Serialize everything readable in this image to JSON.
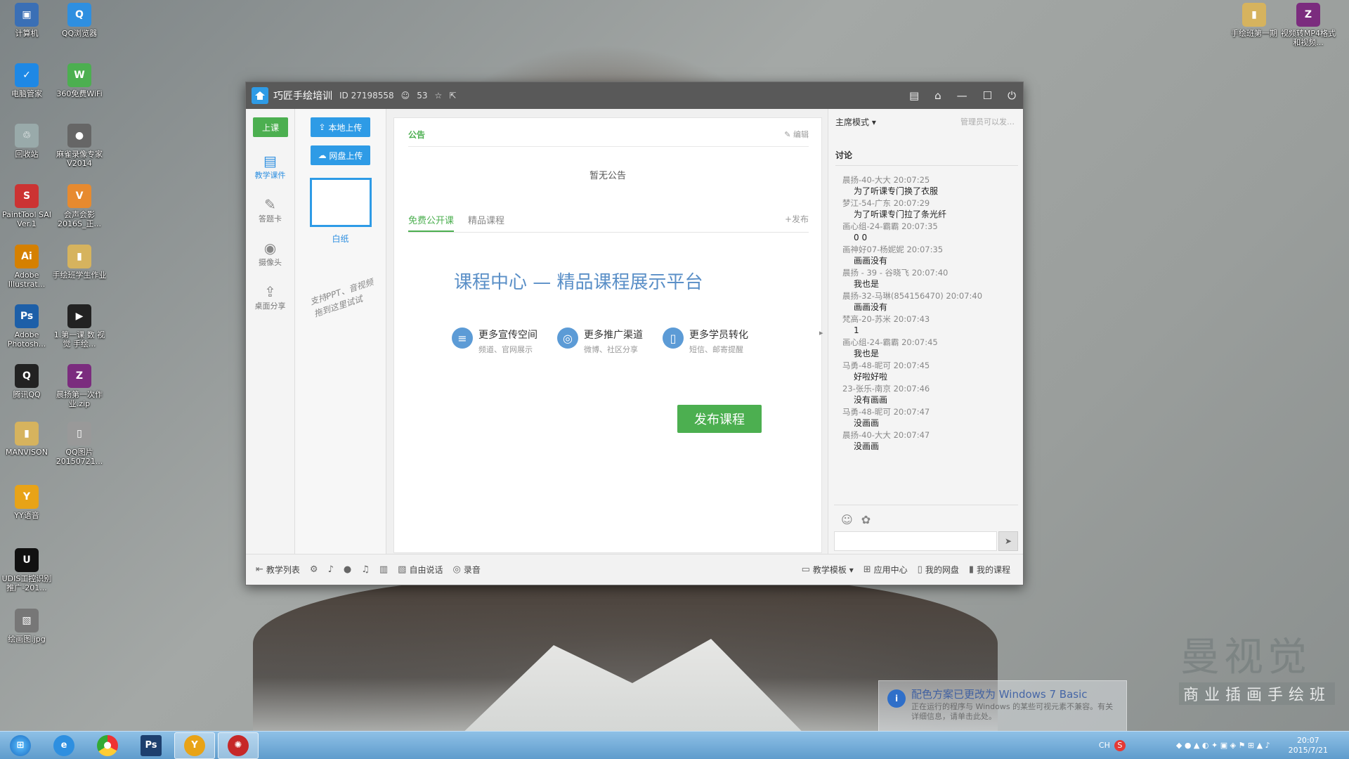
{
  "desktop": {
    "icons": [
      {
        "label": "计算机",
        "color": "#3a6fb5",
        "glyph": "▣"
      },
      {
        "label": "QQ浏览器",
        "color": "#2e8fe0",
        "glyph": "Q"
      },
      {
        "label": "电脑管家",
        "color": "#1e88e5",
        "glyph": "✓"
      },
      {
        "label": "360免费WiFi",
        "color": "#4caf50",
        "glyph": "W"
      },
      {
        "label": "回收站",
        "color": "#9aa",
        "glyph": "♲"
      },
      {
        "label": "麻雀录像专家V2014",
        "color": "#666",
        "glyph": "●"
      },
      {
        "label": "PaintTool SAI Ver.1",
        "color": "#c33",
        "glyph": "S"
      },
      {
        "label": "会声会影2016S_正...",
        "color": "#e78a2f",
        "glyph": "V"
      },
      {
        "label": "Adobe Illustrat...",
        "color": "#d58000",
        "glyph": "Ai"
      },
      {
        "label": "手绘班学生作业",
        "color": "#d6b35e",
        "glyph": "▮"
      },
      {
        "label": "Adobe Photosh...",
        "color": "#1d5fa8",
        "glyph": "Ps"
      },
      {
        "label": "1.第一课 数 视觉 手绘...",
        "color": "#222",
        "glyph": "▶"
      },
      {
        "label": "腾讯QQ",
        "color": "#222",
        "glyph": "Q"
      },
      {
        "label": "晨扬第一次作业.zip",
        "color": "#7b2c7e",
        "glyph": "Z"
      },
      {
        "label": "MANVISON",
        "color": "#d6b35e",
        "glyph": "▮"
      },
      {
        "label": "QQ图片20150721...",
        "color": "#999",
        "glyph": "▯"
      },
      {
        "label": "YY语音",
        "color": "#e8a317",
        "glyph": "Y"
      },
      {
        "label": "UDIS工控识别推广-201...",
        "color": "#111",
        "glyph": "U"
      },
      {
        "label": "绘画图.jpg",
        "color": "#777",
        "glyph": "▧"
      },
      {
        "label": "手绘班第一期",
        "color": "#d6b35e",
        "glyph": "▮"
      },
      {
        "label": "视频转MP4格式和视频...",
        "color": "#7b2c7e",
        "glyph": "Z"
      }
    ]
  },
  "window": {
    "title": "巧匠手绘培训",
    "id": "ID 27198558",
    "online": "53",
    "leftnav": {
      "start": "上课",
      "items": [
        "教学课件",
        "答题卡",
        "摄像头",
        "桌面分享"
      ]
    },
    "upload": {
      "local": "本地上传",
      "cloud": "网盘上传",
      "blank": "白纸",
      "handwriting": "支持PPT、音视频拖到这里试试"
    },
    "notice": {
      "title": "公告",
      "edit": "编辑",
      "empty": "暂无公告"
    },
    "tabs": [
      "免费公开课",
      "精品课程"
    ],
    "publish_link": "+发布",
    "hero": "课程中心 — 精品课程展示平台",
    "features": [
      {
        "title": "更多宣传空间",
        "sub": "频道、官网展示",
        "icon": "≡"
      },
      {
        "title": "更多推广渠道",
        "sub": "微博、社区分享",
        "icon": "◎"
      },
      {
        "title": "更多学员转化",
        "sub": "短信、邮寄提醒",
        "icon": "▯"
      }
    ],
    "publish_button": "发布课程",
    "right": {
      "mode": "主席模式 ▾",
      "hint": "管理员可以发…",
      "discussion": "讨论"
    },
    "messages": [
      {
        "who": "晨扬-40-大大 20:07:25",
        "text": "为了听课专门换了衣服"
      },
      {
        "who": "梦江-54-广东 20:07:29",
        "text": "为了听课专门拉了条光纤"
      },
      {
        "who": "画心组-24-霸霸 20:07:35",
        "text": "0 0"
      },
      {
        "who": "画神好07-杨妮妮 20:07:35",
        "text": "画画没有"
      },
      {
        "who": "晨扬 - 39 - 谷晓飞 20:07:40",
        "text": "我也是"
      },
      {
        "who": "晨扬-32-马琳(854156470) 20:07:40",
        "text": "画画没有"
      },
      {
        "who": "梵高-20-苏米 20:07:43",
        "text": "1"
      },
      {
        "who": "画心组-24-霸霸 20:07:45",
        "text": "我也是"
      },
      {
        "who": "马勇-48-昵可 20:07:45",
        "text": "好啦好啦"
      },
      {
        "who": "23-张乐-南京 20:07:46",
        "text": "没有画画"
      },
      {
        "who": "马勇-48-昵可 20:07:47",
        "text": "没画画"
      },
      {
        "who": "晨扬-40-大大 20:07:47",
        "text": "没画画"
      }
    ],
    "bottom": {
      "left": [
        "教学列表",
        "自由说话",
        "录音"
      ],
      "right": [
        "教学模板 ▾",
        "应用中心",
        "我的网盘",
        "我的课程"
      ]
    }
  },
  "watermark": {
    "main": "曼视觉",
    "sub": "商业插画手绘班"
  },
  "notification": {
    "title": "配色方案已更改为 Windows 7 Basic",
    "body": "正在运行的程序与 Windows 的某些可视元素不兼容。有关详细信息，请单击此处。"
  },
  "taskbar": {
    "ime": "CH",
    "time": "20:07",
    "date": "2015/7/21"
  }
}
